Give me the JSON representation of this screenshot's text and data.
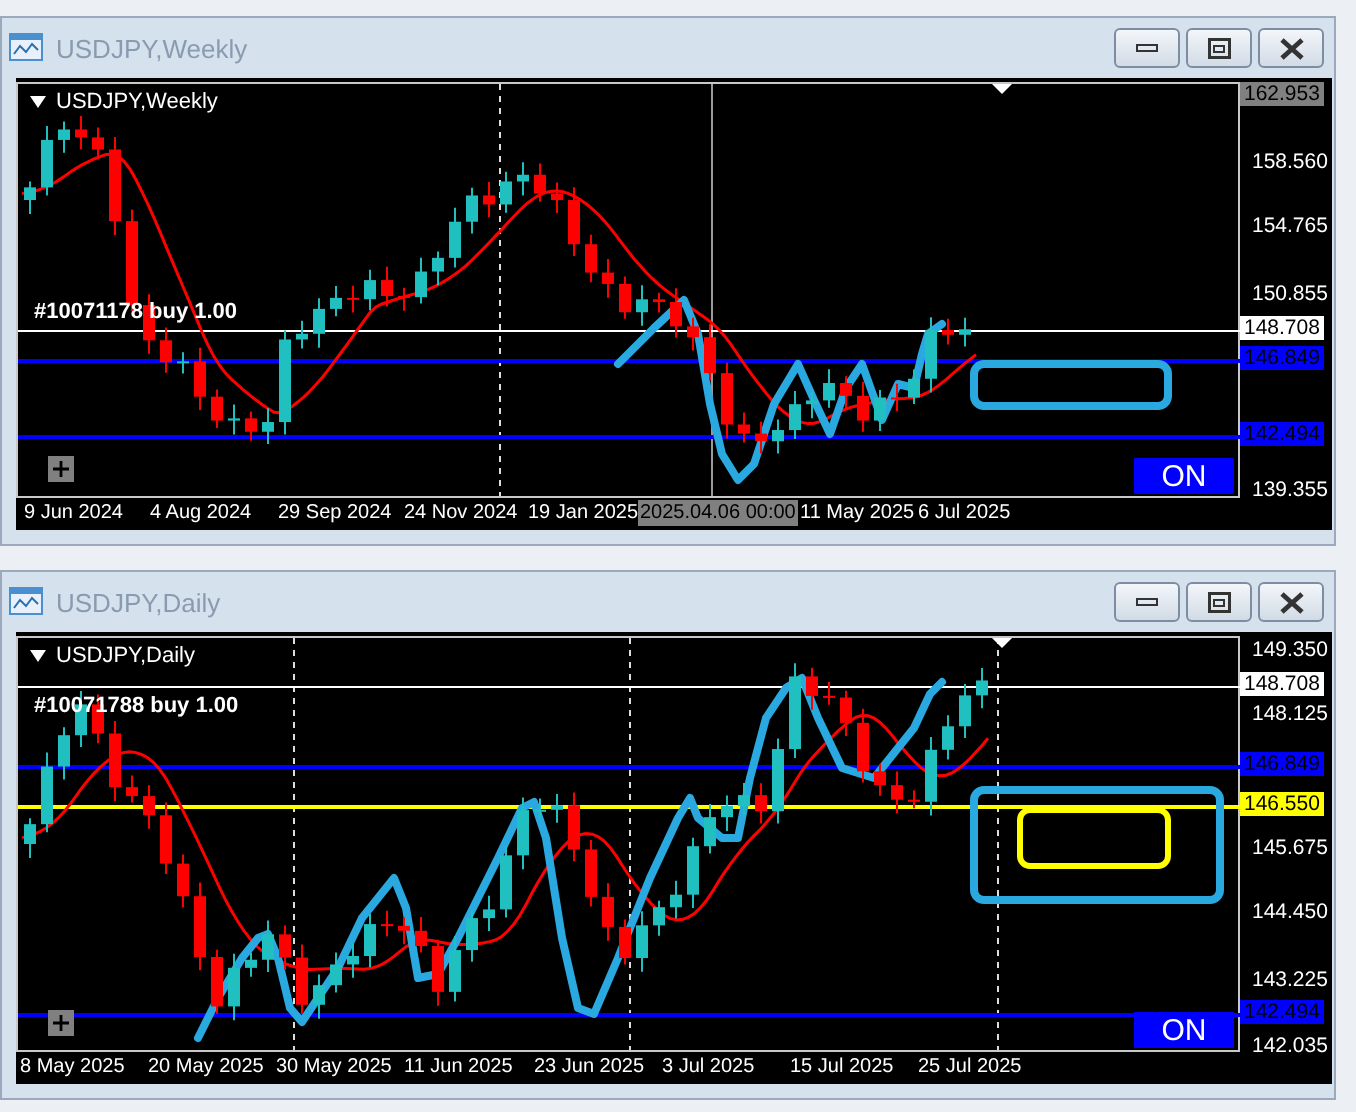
{
  "windows": [
    {
      "title": "USDJPY,Weekly",
      "chart_label": "USDJPY,Weekly",
      "order_label": "#10071178  buy 1.00",
      "on_button": "ON",
      "price_axis": [
        {
          "text": "162.953",
          "kind": "high",
          "color": "#808080"
        },
        {
          "text": "158.560",
          "kind": "tick"
        },
        {
          "text": "154.765",
          "kind": "tick"
        },
        {
          "text": "150.855",
          "kind": "tick"
        },
        {
          "text": "148.708",
          "kind": "current",
          "color": "#ffffff"
        },
        {
          "text": "146.849",
          "kind": "level",
          "color": "#0000ff"
        },
        {
          "text": "142.494",
          "kind": "level",
          "color": "#0000ff"
        },
        {
          "text": "139.355",
          "kind": "tick"
        }
      ],
      "time_axis": [
        {
          "text": "9 Jun 2024",
          "kind": "date"
        },
        {
          "text": "4 Aug 2024",
          "kind": "date"
        },
        {
          "text": "29 Sep 2024",
          "kind": "date"
        },
        {
          "text": "24 Nov 2024",
          "kind": "date"
        },
        {
          "text": "19 Jan 2025",
          "kind": "date"
        },
        {
          "text": "2025.04.06 00:00",
          "kind": "crosshair"
        },
        {
          "text": "11 May 2025",
          "kind": "date"
        },
        {
          "text": "6 Jul 2025",
          "kind": "date"
        }
      ]
    },
    {
      "title": "USDJPY,Daily",
      "chart_label": "USDJPY,Daily",
      "order_label": "#10071788 buy 1.00",
      "on_button": "ON",
      "price_axis": [
        {
          "text": "149.350",
          "kind": "tick"
        },
        {
          "text": "148.708",
          "kind": "current",
          "color": "#ffffff"
        },
        {
          "text": "148.125",
          "kind": "tick"
        },
        {
          "text": "146.849",
          "kind": "level",
          "color": "#0000ff"
        },
        {
          "text": "146.550",
          "kind": "level",
          "color": "#ffff00"
        },
        {
          "text": "145.675",
          "kind": "tick"
        },
        {
          "text": "144.450",
          "kind": "tick"
        },
        {
          "text": "143.225",
          "kind": "tick"
        },
        {
          "text": "142.494",
          "kind": "level",
          "color": "#0000ff"
        },
        {
          "text": "142.035",
          "kind": "tick"
        }
      ],
      "time_axis": [
        {
          "text": "8 May 2025",
          "kind": "date"
        },
        {
          "text": "20 May 2025",
          "kind": "date"
        },
        {
          "text": "30 May 2025",
          "kind": "date"
        },
        {
          "text": "11 Jun 2025",
          "kind": "date"
        },
        {
          "text": "23 Jun 2025",
          "kind": "date"
        },
        {
          "text": "3 Jul 2025",
          "kind": "date"
        },
        {
          "text": "15 Jul 2025",
          "kind": "date"
        },
        {
          "text": "25 Jul 2025",
          "kind": "date"
        }
      ]
    }
  ]
}
